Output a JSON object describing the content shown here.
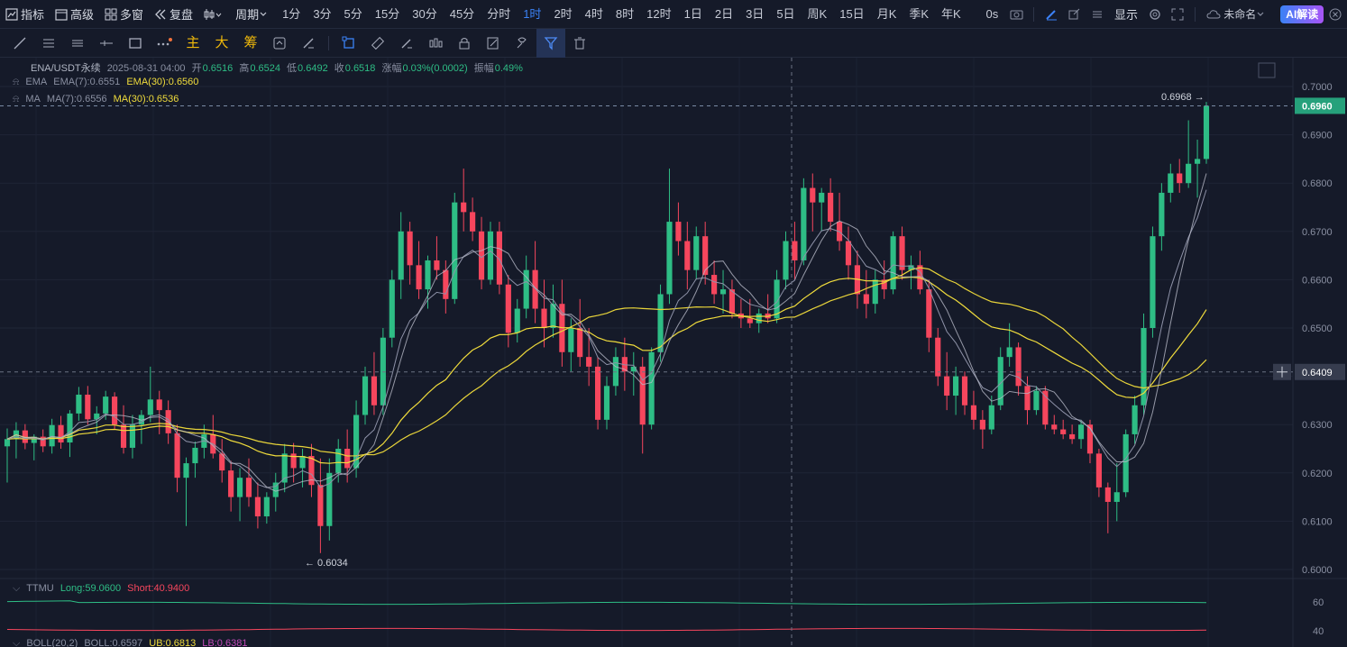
{
  "topbar": {
    "indicator": "指标",
    "advanced": "高级",
    "multi_window": "多窗",
    "replay": "复盘",
    "period_menu": "周期",
    "periods": [
      "1分",
      "3分",
      "5分",
      "15分",
      "30分",
      "45分",
      "分时",
      "1时",
      "2时",
      "4时",
      "8时",
      "12时",
      "1日",
      "2日",
      "3日",
      "5日",
      "周K",
      "15日",
      "月K",
      "季K",
      "年K"
    ],
    "active_period": "1时",
    "timer": "0s",
    "display": "显示",
    "layout_name": "未命名",
    "ai": "AI解读"
  },
  "toolbar2": {
    "main": "主",
    "big": "大",
    "chips": "筹"
  },
  "legend": {
    "symbol": "ENA/USDT永续",
    "time": "2025-08-31 04:00",
    "open_label": "开",
    "open": "0.6516",
    "high_label": "高",
    "high": "0.6524",
    "low_label": "低",
    "low": "0.6492",
    "close_label": "收",
    "close": "0.6518",
    "change_label": "涨幅",
    "change": "0.03%(0.0002)",
    "amp_label": "振幅",
    "amp": "0.49%",
    "ema_name": "EMA",
    "ema7": "EMA(7):0.6551",
    "ema30": "EMA(30):0.6560",
    "ma_name": "MA",
    "ma7": "MA(7):0.6556",
    "ma30": "MA(30):0.6536"
  },
  "sub": {
    "ttmu_name": "TTMU",
    "long": "Long:59.0600",
    "short": "Short:40.9400",
    "boll_name": "BOLL(20,2)",
    "boll": "BOLL:0.6597",
    "ub": "UB:0.6813",
    "lb": "LB:0.6381",
    "ticks": [
      "60",
      "40"
    ]
  },
  "price_axis": {
    "ticks": [
      "0.7000",
      "0.6900",
      "0.6800",
      "0.6700",
      "0.6600",
      "0.6500",
      "0.6400",
      "0.6300",
      "0.6200",
      "0.6100",
      "0.6000"
    ],
    "last_price": "0.6960",
    "crosshair_price": "0.6409",
    "high_marker": "0.6968 →",
    "low_marker": "← 0.6034"
  },
  "chart_data": {
    "type": "candlestick",
    "ylim": [
      0.6,
      0.7
    ],
    "colors": {
      "up": "#2ebd85",
      "down": "#f6465d",
      "ema7": "#8e92a8",
      "ema30": "#f0dc3c",
      "ma7": "#b7b9c7",
      "ma30": "#e8d43a"
    },
    "candles": [
      {
        "o": 0.6255,
        "h": 0.6292,
        "l": 0.618,
        "c": 0.627
      },
      {
        "o": 0.627,
        "h": 0.6305,
        "l": 0.623,
        "c": 0.6288
      },
      {
        "o": 0.6288,
        "h": 0.6301,
        "l": 0.6249,
        "c": 0.6262
      },
      {
        "o": 0.6262,
        "h": 0.628,
        "l": 0.6226,
        "c": 0.6275
      },
      {
        "o": 0.6275,
        "h": 0.629,
        "l": 0.6243,
        "c": 0.6255
      },
      {
        "o": 0.6255,
        "h": 0.6312,
        "l": 0.624,
        "c": 0.6299
      },
      {
        "o": 0.6299,
        "h": 0.6318,
        "l": 0.625,
        "c": 0.6263
      },
      {
        "o": 0.6263,
        "h": 0.633,
        "l": 0.6233,
        "c": 0.6323
      },
      {
        "o": 0.6323,
        "h": 0.6378,
        "l": 0.6308,
        "c": 0.6362
      },
      {
        "o": 0.6362,
        "h": 0.638,
        "l": 0.63,
        "c": 0.6311
      },
      {
        "o": 0.6311,
        "h": 0.6338,
        "l": 0.628,
        "c": 0.6323
      },
      {
        "o": 0.6323,
        "h": 0.637,
        "l": 0.631,
        "c": 0.6358
      },
      {
        "o": 0.6358,
        "h": 0.6367,
        "l": 0.629,
        "c": 0.63
      },
      {
        "o": 0.63,
        "h": 0.634,
        "l": 0.624,
        "c": 0.6252
      },
      {
        "o": 0.6252,
        "h": 0.632,
        "l": 0.623,
        "c": 0.63
      },
      {
        "o": 0.63,
        "h": 0.633,
        "l": 0.626,
        "c": 0.632
      },
      {
        "o": 0.632,
        "h": 0.642,
        "l": 0.6305,
        "c": 0.6352
      },
      {
        "o": 0.6352,
        "h": 0.637,
        "l": 0.628,
        "c": 0.633
      },
      {
        "o": 0.633,
        "h": 0.635,
        "l": 0.626,
        "c": 0.6282
      },
      {
        "o": 0.6282,
        "h": 0.63,
        "l": 0.616,
        "c": 0.619
      },
      {
        "o": 0.619,
        "h": 0.6232,
        "l": 0.609,
        "c": 0.622
      },
      {
        "o": 0.622,
        "h": 0.6265,
        "l": 0.619,
        "c": 0.6252
      },
      {
        "o": 0.6252,
        "h": 0.63,
        "l": 0.623,
        "c": 0.628
      },
      {
        "o": 0.628,
        "h": 0.632,
        "l": 0.623,
        "c": 0.624
      },
      {
        "o": 0.624,
        "h": 0.627,
        "l": 0.618,
        "c": 0.6205
      },
      {
        "o": 0.6205,
        "h": 0.6225,
        "l": 0.612,
        "c": 0.615
      },
      {
        "o": 0.615,
        "h": 0.621,
        "l": 0.61,
        "c": 0.619
      },
      {
        "o": 0.619,
        "h": 0.623,
        "l": 0.613,
        "c": 0.615
      },
      {
        "o": 0.615,
        "h": 0.618,
        "l": 0.6085,
        "c": 0.611
      },
      {
        "o": 0.611,
        "h": 0.616,
        "l": 0.6095,
        "c": 0.615
      },
      {
        "o": 0.615,
        "h": 0.62,
        "l": 0.612,
        "c": 0.618
      },
      {
        "o": 0.618,
        "h": 0.626,
        "l": 0.616,
        "c": 0.624
      },
      {
        "o": 0.624,
        "h": 0.6262,
        "l": 0.618,
        "c": 0.621
      },
      {
        "o": 0.621,
        "h": 0.625,
        "l": 0.617,
        "c": 0.6235
      },
      {
        "o": 0.6235,
        "h": 0.626,
        "l": 0.615,
        "c": 0.6175
      },
      {
        "o": 0.6175,
        "h": 0.623,
        "l": 0.6034,
        "c": 0.609
      },
      {
        "o": 0.609,
        "h": 0.623,
        "l": 0.606,
        "c": 0.62
      },
      {
        "o": 0.62,
        "h": 0.627,
        "l": 0.618,
        "c": 0.625
      },
      {
        "o": 0.625,
        "h": 0.629,
        "l": 0.618,
        "c": 0.621
      },
      {
        "o": 0.621,
        "h": 0.635,
        "l": 0.619,
        "c": 0.632
      },
      {
        "o": 0.632,
        "h": 0.642,
        "l": 0.63,
        "c": 0.64
      },
      {
        "o": 0.64,
        "h": 0.645,
        "l": 0.632,
        "c": 0.634
      },
      {
        "o": 0.634,
        "h": 0.65,
        "l": 0.632,
        "c": 0.648
      },
      {
        "o": 0.648,
        "h": 0.662,
        "l": 0.646,
        "c": 0.66
      },
      {
        "o": 0.66,
        "h": 0.674,
        "l": 0.656,
        "c": 0.67
      },
      {
        "o": 0.67,
        "h": 0.672,
        "l": 0.659,
        "c": 0.663
      },
      {
        "o": 0.663,
        "h": 0.668,
        "l": 0.656,
        "c": 0.658
      },
      {
        "o": 0.658,
        "h": 0.665,
        "l": 0.654,
        "c": 0.664
      },
      {
        "o": 0.664,
        "h": 0.669,
        "l": 0.66,
        "c": 0.662
      },
      {
        "o": 0.662,
        "h": 0.664,
        "l": 0.653,
        "c": 0.656
      },
      {
        "o": 0.656,
        "h": 0.678,
        "l": 0.655,
        "c": 0.676
      },
      {
        "o": 0.676,
        "h": 0.683,
        "l": 0.67,
        "c": 0.674
      },
      {
        "o": 0.674,
        "h": 0.677,
        "l": 0.668,
        "c": 0.67
      },
      {
        "o": 0.67,
        "h": 0.673,
        "l": 0.658,
        "c": 0.66
      },
      {
        "o": 0.66,
        "h": 0.672,
        "l": 0.659,
        "c": 0.67
      },
      {
        "o": 0.67,
        "h": 0.672,
        "l": 0.657,
        "c": 0.659
      },
      {
        "o": 0.659,
        "h": 0.661,
        "l": 0.646,
        "c": 0.649
      },
      {
        "o": 0.649,
        "h": 0.656,
        "l": 0.647,
        "c": 0.654
      },
      {
        "o": 0.654,
        "h": 0.665,
        "l": 0.652,
        "c": 0.662
      },
      {
        "o": 0.662,
        "h": 0.668,
        "l": 0.651,
        "c": 0.654
      },
      {
        "o": 0.654,
        "h": 0.66,
        "l": 0.646,
        "c": 0.65
      },
      {
        "o": 0.65,
        "h": 0.659,
        "l": 0.648,
        "c": 0.655
      },
      {
        "o": 0.655,
        "h": 0.66,
        "l": 0.642,
        "c": 0.645
      },
      {
        "o": 0.645,
        "h": 0.652,
        "l": 0.641,
        "c": 0.65
      },
      {
        "o": 0.65,
        "h": 0.656,
        "l": 0.642,
        "c": 0.644
      },
      {
        "o": 0.644,
        "h": 0.65,
        "l": 0.638,
        "c": 0.642
      },
      {
        "o": 0.642,
        "h": 0.644,
        "l": 0.629,
        "c": 0.631
      },
      {
        "o": 0.631,
        "h": 0.64,
        "l": 0.629,
        "c": 0.638
      },
      {
        "o": 0.638,
        "h": 0.646,
        "l": 0.636,
        "c": 0.644
      },
      {
        "o": 0.644,
        "h": 0.648,
        "l": 0.637,
        "c": 0.641
      },
      {
        "o": 0.641,
        "h": 0.645,
        "l": 0.636,
        "c": 0.642
      },
      {
        "o": 0.642,
        "h": 0.644,
        "l": 0.624,
        "c": 0.63
      },
      {
        "o": 0.63,
        "h": 0.646,
        "l": 0.629,
        "c": 0.645
      },
      {
        "o": 0.645,
        "h": 0.659,
        "l": 0.643,
        "c": 0.657
      },
      {
        "o": 0.657,
        "h": 0.683,
        "l": 0.655,
        "c": 0.672
      },
      {
        "o": 0.672,
        "h": 0.676,
        "l": 0.665,
        "c": 0.668
      },
      {
        "o": 0.668,
        "h": 0.672,
        "l": 0.658,
        "c": 0.662
      },
      {
        "o": 0.662,
        "h": 0.671,
        "l": 0.66,
        "c": 0.669
      },
      {
        "o": 0.669,
        "h": 0.672,
        "l": 0.659,
        "c": 0.661
      },
      {
        "o": 0.661,
        "h": 0.664,
        "l": 0.655,
        "c": 0.657
      },
      {
        "o": 0.657,
        "h": 0.662,
        "l": 0.653,
        "c": 0.658
      },
      {
        "o": 0.658,
        "h": 0.66,
        "l": 0.652,
        "c": 0.653
      },
      {
        "o": 0.653,
        "h": 0.656,
        "l": 0.65,
        "c": 0.652
      },
      {
        "o": 0.652,
        "h": 0.656,
        "l": 0.65,
        "c": 0.651
      },
      {
        "o": 0.651,
        "h": 0.654,
        "l": 0.649,
        "c": 0.653
      },
      {
        "o": 0.653,
        "h": 0.657,
        "l": 0.651,
        "c": 0.652
      },
      {
        "o": 0.652,
        "h": 0.662,
        "l": 0.651,
        "c": 0.66
      },
      {
        "o": 0.66,
        "h": 0.67,
        "l": 0.658,
        "c": 0.668
      },
      {
        "o": 0.668,
        "h": 0.672,
        "l": 0.66,
        "c": 0.664
      },
      {
        "o": 0.664,
        "h": 0.681,
        "l": 0.663,
        "c": 0.679
      },
      {
        "o": 0.679,
        "h": 0.682,
        "l": 0.67,
        "c": 0.676
      },
      {
        "o": 0.676,
        "h": 0.679,
        "l": 0.67,
        "c": 0.678
      },
      {
        "o": 0.678,
        "h": 0.681,
        "l": 0.67,
        "c": 0.672
      },
      {
        "o": 0.672,
        "h": 0.678,
        "l": 0.666,
        "c": 0.668
      },
      {
        "o": 0.668,
        "h": 0.671,
        "l": 0.66,
        "c": 0.663
      },
      {
        "o": 0.663,
        "h": 0.666,
        "l": 0.654,
        "c": 0.657
      },
      {
        "o": 0.657,
        "h": 0.662,
        "l": 0.652,
        "c": 0.655
      },
      {
        "o": 0.655,
        "h": 0.662,
        "l": 0.653,
        "c": 0.66
      },
      {
        "o": 0.66,
        "h": 0.664,
        "l": 0.656,
        "c": 0.658
      },
      {
        "o": 0.658,
        "h": 0.67,
        "l": 0.657,
        "c": 0.669
      },
      {
        "o": 0.669,
        "h": 0.671,
        "l": 0.66,
        "c": 0.662
      },
      {
        "o": 0.662,
        "h": 0.665,
        "l": 0.658,
        "c": 0.663
      },
      {
        "o": 0.663,
        "h": 0.666,
        "l": 0.657,
        "c": 0.658
      },
      {
        "o": 0.658,
        "h": 0.66,
        "l": 0.645,
        "c": 0.648
      },
      {
        "o": 0.648,
        "h": 0.65,
        "l": 0.638,
        "c": 0.64
      },
      {
        "o": 0.64,
        "h": 0.645,
        "l": 0.633,
        "c": 0.636
      },
      {
        "o": 0.636,
        "h": 0.642,
        "l": 0.632,
        "c": 0.64
      },
      {
        "o": 0.64,
        "h": 0.641,
        "l": 0.632,
        "c": 0.634
      },
      {
        "o": 0.634,
        "h": 0.637,
        "l": 0.629,
        "c": 0.631
      },
      {
        "o": 0.631,
        "h": 0.633,
        "l": 0.625,
        "c": 0.629
      },
      {
        "o": 0.629,
        "h": 0.636,
        "l": 0.628,
        "c": 0.634
      },
      {
        "o": 0.634,
        "h": 0.646,
        "l": 0.633,
        "c": 0.644
      },
      {
        "o": 0.644,
        "h": 0.651,
        "l": 0.642,
        "c": 0.646
      },
      {
        "o": 0.646,
        "h": 0.647,
        "l": 0.636,
        "c": 0.638
      },
      {
        "o": 0.638,
        "h": 0.64,
        "l": 0.63,
        "c": 0.633
      },
      {
        "o": 0.633,
        "h": 0.638,
        "l": 0.632,
        "c": 0.637
      },
      {
        "o": 0.637,
        "h": 0.638,
        "l": 0.629,
        "c": 0.63
      },
      {
        "o": 0.63,
        "h": 0.632,
        "l": 0.628,
        "c": 0.629
      },
      {
        "o": 0.629,
        "h": 0.631,
        "l": 0.627,
        "c": 0.628
      },
      {
        "o": 0.628,
        "h": 0.63,
        "l": 0.626,
        "c": 0.627
      },
      {
        "o": 0.627,
        "h": 0.631,
        "l": 0.625,
        "c": 0.63
      },
      {
        "o": 0.63,
        "h": 0.631,
        "l": 0.622,
        "c": 0.624
      },
      {
        "o": 0.624,
        "h": 0.625,
        "l": 0.615,
        "c": 0.617
      },
      {
        "o": 0.617,
        "h": 0.618,
        "l": 0.6075,
        "c": 0.614
      },
      {
        "o": 0.614,
        "h": 0.622,
        "l": 0.61,
        "c": 0.616
      },
      {
        "o": 0.616,
        "h": 0.629,
        "l": 0.615,
        "c": 0.628
      },
      {
        "o": 0.628,
        "h": 0.636,
        "l": 0.626,
        "c": 0.634
      },
      {
        "o": 0.634,
        "h": 0.653,
        "l": 0.632,
        "c": 0.65
      },
      {
        "o": 0.65,
        "h": 0.671,
        "l": 0.648,
        "c": 0.669
      },
      {
        "o": 0.669,
        "h": 0.68,
        "l": 0.666,
        "c": 0.678
      },
      {
        "o": 0.678,
        "h": 0.684,
        "l": 0.676,
        "c": 0.682
      },
      {
        "o": 0.682,
        "h": 0.685,
        "l": 0.678,
        "c": 0.68
      },
      {
        "o": 0.68,
        "h": 0.693,
        "l": 0.679,
        "c": 0.684
      },
      {
        "o": 0.684,
        "h": 0.689,
        "l": 0.677,
        "c": 0.685
      },
      {
        "o": 0.685,
        "h": 0.6968,
        "l": 0.684,
        "c": 0.696
      }
    ]
  }
}
